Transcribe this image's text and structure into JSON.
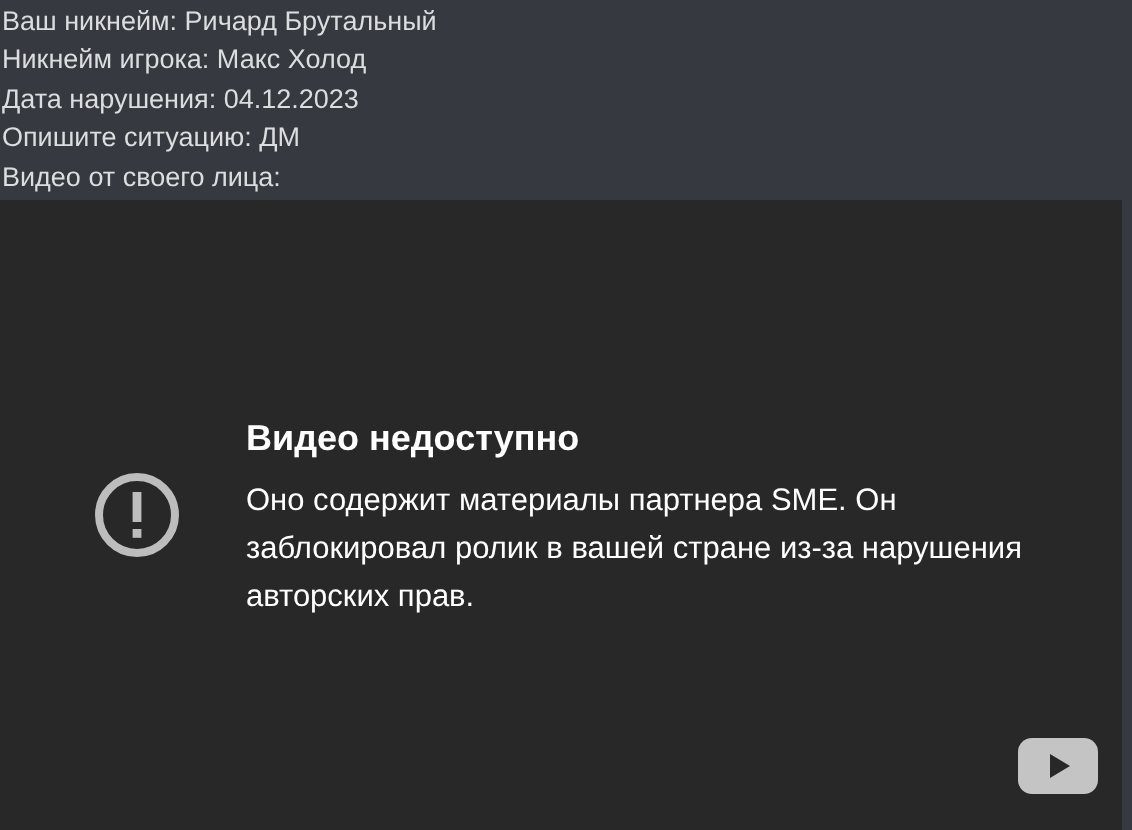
{
  "message_lines": [
    "Ваш никнейм: Ричард Брутальный",
    "Никнейм игрока: Макс Холод",
    "Дата нарушения: 04.12.2023",
    "Опишите ситуацию: ДМ",
    "Видео от своего лица:"
  ],
  "video": {
    "error_title": "Видео недоступно",
    "error_text": "Оно содержит материалы партнера SME. Он заблокировал ролик в вашей стране из-за нарушения авторских прав."
  }
}
